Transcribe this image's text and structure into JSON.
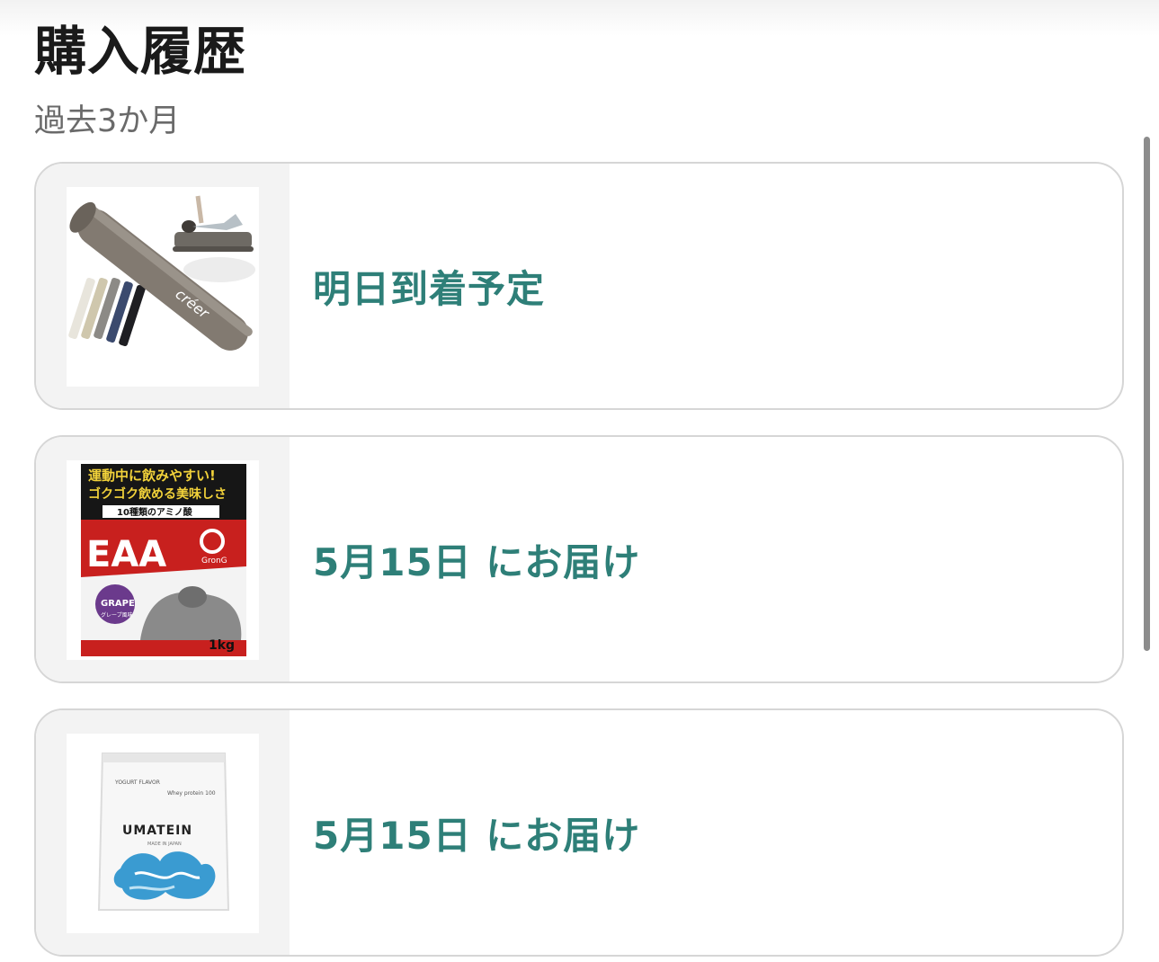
{
  "header": {
    "title": "購入履歴",
    "period": "過去3か月"
  },
  "orders": [
    {
      "image_icon": "foam-roller-product-image",
      "brand_mark": "créer",
      "status": "明日到着予定"
    },
    {
      "image_icon": "eaa-supplement-product-image",
      "banner_line1": "運動中に飲みやすい!",
      "banner_line2": "ゴクゴク飲める美味しさ",
      "banner_line3": "10種類のアミノ酸",
      "product_name": "EAA",
      "brand": "GronG",
      "flavor": "GRAPE",
      "flavor_jp": "グレープ風味",
      "weight": "1kg",
      "status": "5月15日 にお届け"
    },
    {
      "image_icon": "umatein-protein-product-image",
      "flavor_label": "YOGURT FLAVOR",
      "sub_label": "Whey protein 100",
      "product_name": "UMATEIN",
      "made_in": "MADE IN JAPAN",
      "status": "5月15日 にお届け"
    }
  ],
  "colors": {
    "status_text": "#2e7f78",
    "card_border": "#d6d6d6",
    "eaa_red": "#c8201e",
    "grape_purple": "#6b3a8c",
    "umatein_blue": "#3a9bd1"
  }
}
